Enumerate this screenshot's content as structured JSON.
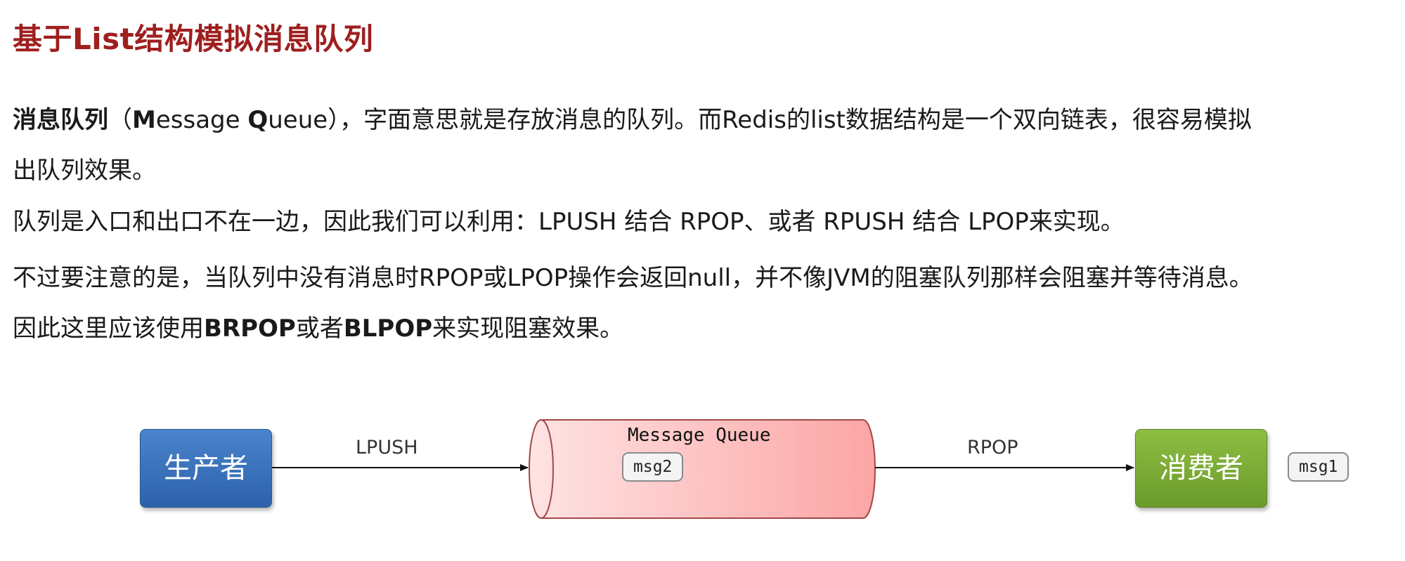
{
  "title": "基于List结构模拟消息队列",
  "para1": {
    "bold_term": "消息队列",
    "open_paren": "（",
    "m_bold": "M",
    "essage": "essage ",
    "q_bold": "Q",
    "ueue": "ueue",
    "rest_line1": "），字面意思就是存放消息的队列。而Redis的list数据结构是一个双向链表，很容易模拟",
    "line2": "出队列效果。"
  },
  "para2": "队列是入口和出口不在一边，因此我们可以利用：LPUSH 结合 RPOP、或者 RPUSH 结合 LPOP来实现。",
  "para3": {
    "line1": "不过要注意的是，当队列中没有消息时RPOP或LPOP操作会返回null，并不像JVM的阻塞队列那样会阻塞并等待消息。",
    "line2_prefix": "因此这里应该使用",
    "brpop": "BRPOP",
    "or": "或者",
    "blpop": "BLPOP",
    "line2_suffix": "来实现阻塞效果。"
  },
  "diagram": {
    "producer": "生产者",
    "consumer": "消费者",
    "lpush": "LPUSH",
    "rpop": "RPOP",
    "queue_title": "Message Queue",
    "msg_in_queue": "msg2",
    "msg_consumed": "msg1",
    "colors": {
      "producer": "#2d62ab",
      "consumer": "#6a9b2b",
      "queue_fill": "#fca5a5",
      "title": "#9e1f1f"
    }
  }
}
